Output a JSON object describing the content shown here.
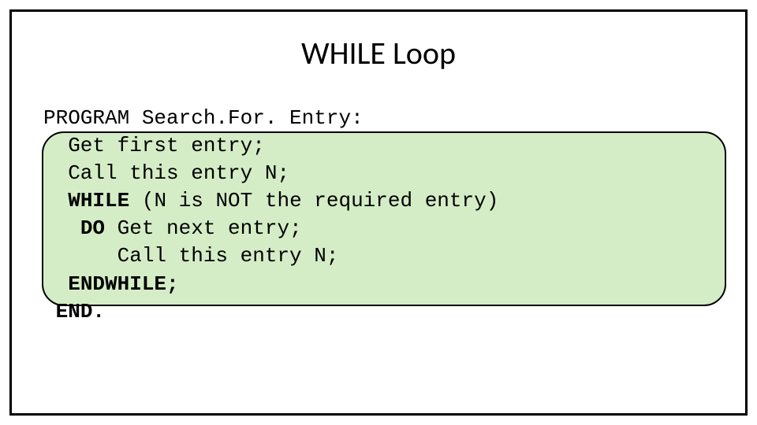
{
  "title": "WHILE Loop",
  "code": {
    "l1a": "PROGRAM",
    "l1b": " Search.For. Entry:",
    "l2": "  Get first entry;",
    "l3": "  Call this entry N;",
    "l4a": "  ",
    "l4b": "WHILE",
    "l4c": " (N is NOT the required entry)",
    "l5a": "   ",
    "l5b": "DO",
    "l5c": " Get next entry;",
    "l6": "      Call this entry N;",
    "l7a": "  ",
    "l7b": "ENDWHILE;",
    "l8a": " ",
    "l8b": "END."
  }
}
